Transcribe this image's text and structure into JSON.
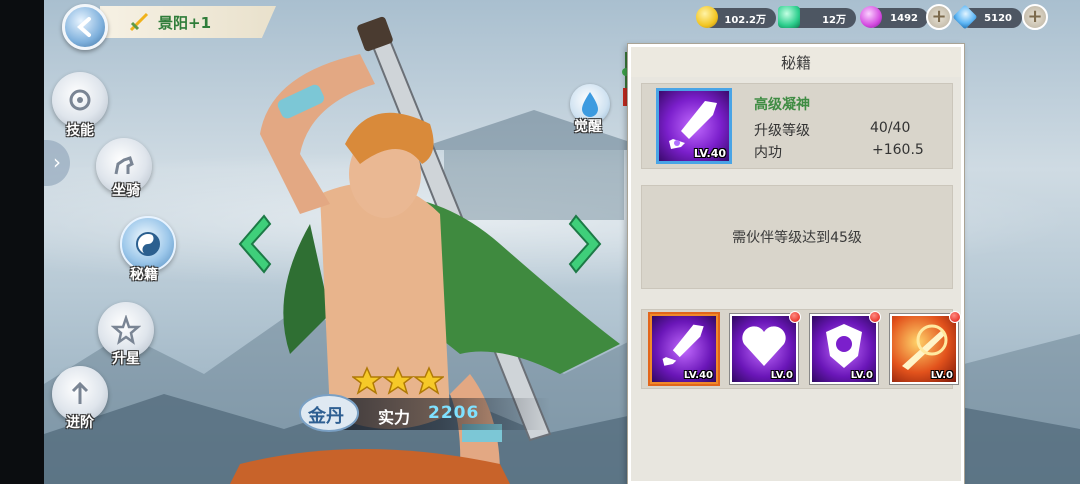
{
  "header": {
    "title": "景阳+1",
    "resources": [
      {
        "name": "gold",
        "value": "102.2万",
        "color": "#f3c623",
        "icon": "gold-coin-icon"
      },
      {
        "name": "jade",
        "value": "12万",
        "color": "#2ecf8e",
        "icon": "green-gem-icon"
      },
      {
        "name": "orb",
        "value": "1492",
        "color": "#d44be0",
        "icon": "purple-orb-icon"
      },
      {
        "name": "diamond",
        "value": "5120",
        "color": "#5fb7f5",
        "icon": "diamond-icon"
      }
    ]
  },
  "side_menu": [
    {
      "label": "技能",
      "icon": "skill-icon"
    },
    {
      "label": "坐骑",
      "icon": "horse-icon"
    },
    {
      "label": "秘籍",
      "icon": "taichi-icon",
      "active": true
    },
    {
      "label": "升星",
      "icon": "stars-icon"
    },
    {
      "label": "进阶",
      "icon": "upgrade-arrow-icon"
    }
  ],
  "awaken_label": "觉醒",
  "hero": {
    "rank": "金丹",
    "power_label": "实力",
    "power_value": "2206",
    "stars": 3
  },
  "panel": {
    "title": "秘籍",
    "selected": {
      "name": "高级凝神",
      "level_tag": "LV.40",
      "stats": [
        {
          "label": "升级等级",
          "value": "40/40"
        },
        {
          "label": "内功",
          "value": "+160.5"
        }
      ]
    },
    "requirement": "需伙伴等级达到45级",
    "slots": [
      {
        "icon": "sword-icon",
        "level": "LV.40",
        "selected": true,
        "alert": false
      },
      {
        "icon": "heart-icon",
        "level": "LV.0",
        "selected": false,
        "alert": true
      },
      {
        "icon": "shield-icon",
        "level": "LV.0",
        "selected": false,
        "alert": true
      },
      {
        "icon": "fire-slash-icon",
        "level": "LV.0",
        "selected": false,
        "alert": true
      }
    ]
  }
}
